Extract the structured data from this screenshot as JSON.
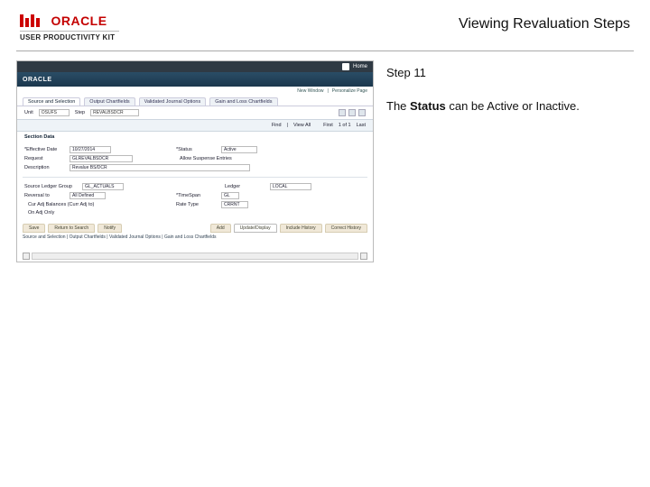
{
  "brand": {
    "name": "ORACLE",
    "subtitle": "USER PRODUCTIVITY KIT"
  },
  "page": {
    "title": "Viewing Revaluation Steps"
  },
  "instruction": {
    "step_label": "Step 11",
    "desc_before": "The ",
    "desc_bold": "Status",
    "desc_after": " can be Active or Inactive."
  },
  "shot": {
    "home": "Home",
    "brand": "ORACLE",
    "sublinks": [
      "New Window",
      "Personalize Page"
    ],
    "tabs": [
      "Source and Selection",
      "Output Chartfields",
      "Validated Journal Options",
      "Gain and Loss Chartfields"
    ],
    "findrow": {
      "find": "Find",
      "view": "View All",
      "first": "First",
      "count": "1 of 1",
      "last": "Last"
    },
    "unitrow": {
      "unit_lbl": "Unit",
      "unit_val": "OSUFS",
      "step_lbl": "Step",
      "step_val": "REVALBSDCR"
    },
    "sectionhdr": "Section Data",
    "fields": {
      "effdate_lbl": "*Effective Date",
      "effdate_val": "10/27/2014",
      "status_lbl": "*Status",
      "status_val": "Active",
      "request_lbl": "Request",
      "request_val": "GLREVALBSDCR",
      "desc_lbl": "Description",
      "desc_val": "Revalue BS/DCR",
      "allow_lbl": "Allow Suspense Entries",
      "srcgrp_lbl": "Source Ledger Group",
      "srcgrp_val": "GL_ACTUALS",
      "tt_lbl": "Reversal to",
      "tt_val": "All Defined",
      "ledger_lbl": "Ledger",
      "ledger_val": "LOCAL",
      "tspan_lbl": "*TimeSpan",
      "tspan_val": "GL",
      "curbal_lbl": "Cur Adj Balances (Curr Adj to)",
      "rate_lbl": "Rate Type",
      "rate_val": "CRRNT",
      "curadj_lbl": "On Adj Only"
    },
    "tabs2_left": [
      "Save",
      "Return to Search",
      "Notify"
    ],
    "tabs2_right": [
      "Add",
      "Update/Display",
      "Include History",
      "Correct History"
    ],
    "footer": "Source and Selection | Output Chartfields | Validated Journal Options | Gain and Loss Chartfields"
  }
}
